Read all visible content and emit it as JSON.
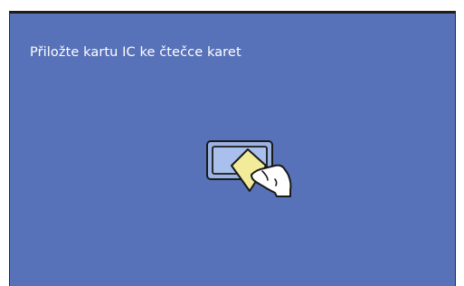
{
  "screen": {
    "instruction": "Přiložte kartu IC ke čtečce karet",
    "background_color": "#5872b9",
    "text_color": "#ffffff"
  },
  "illustration": {
    "icon": "hand-placing-card-on-reader-icon",
    "reader_color": "#9bb3e3",
    "card_color": "#f2ec9a",
    "hand_color": "#ffffff"
  }
}
